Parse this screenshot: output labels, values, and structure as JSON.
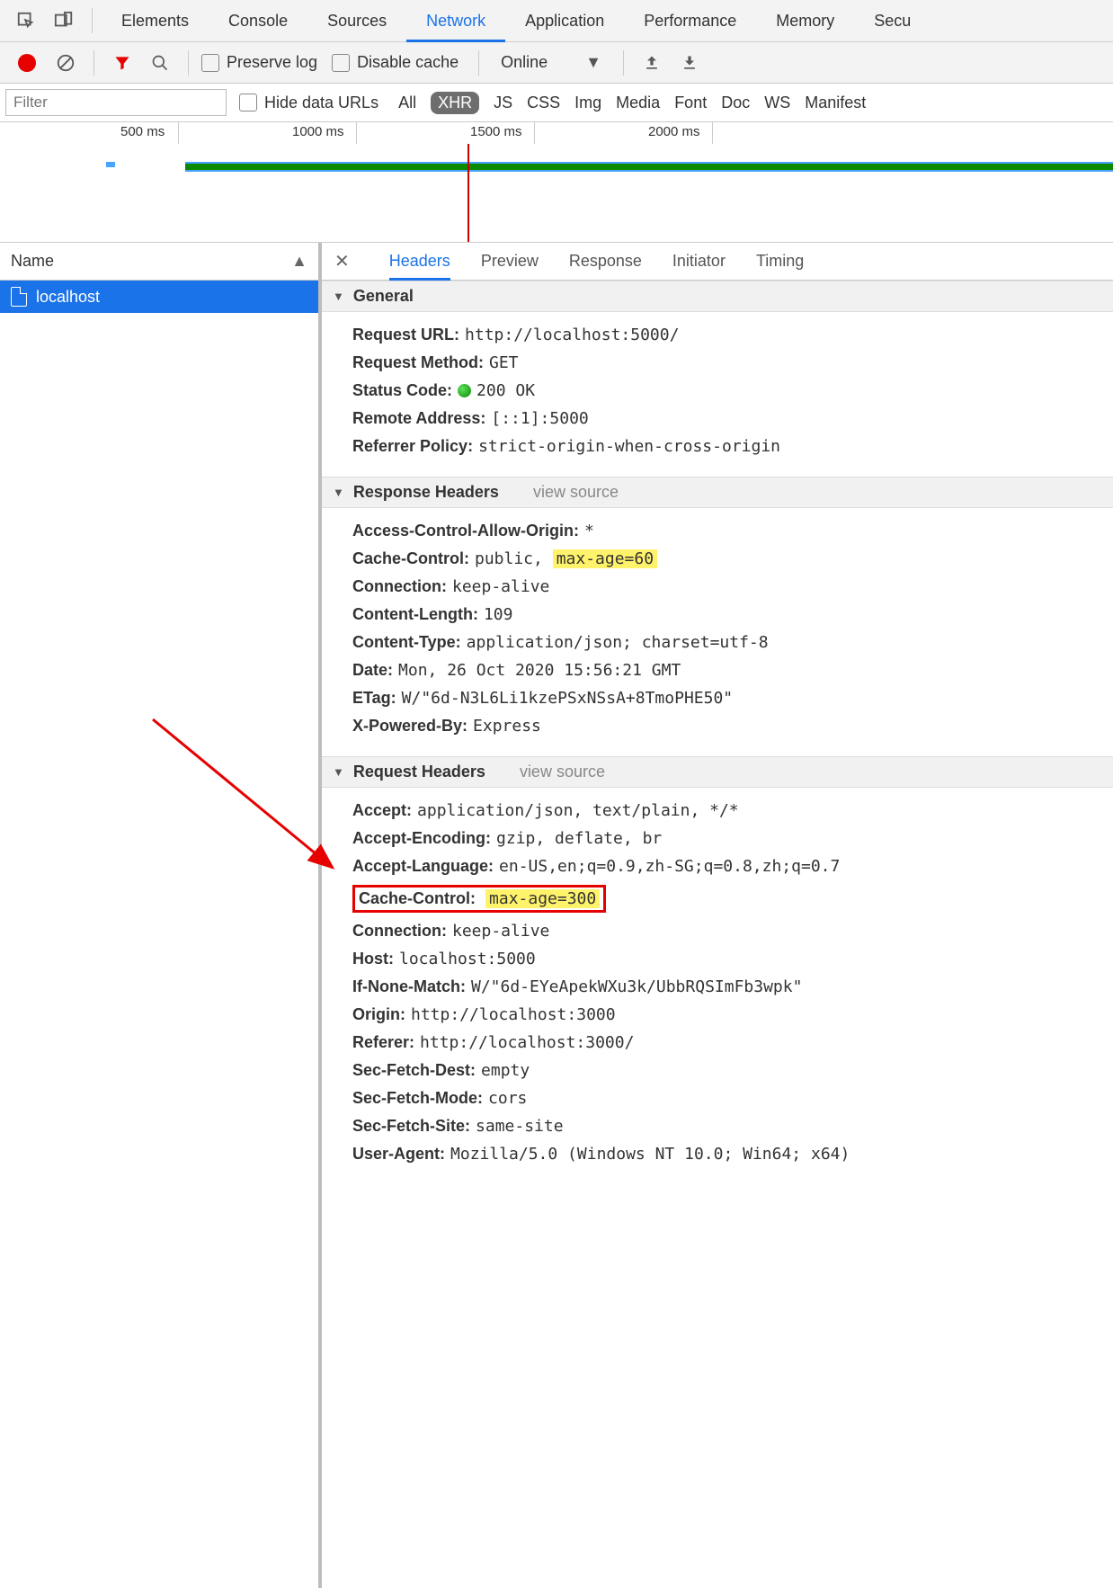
{
  "top_tabs": [
    "Elements",
    "Console",
    "Sources",
    "Network",
    "Application",
    "Performance",
    "Memory",
    "Secu"
  ],
  "top_active": "Network",
  "secondbar": {
    "preserve_log": "Preserve log",
    "disable_cache": "Disable cache",
    "throttle": "Online"
  },
  "filterbar": {
    "placeholder": "Filter",
    "hide_urls": "Hide data URLs",
    "types": [
      "All",
      "XHR",
      "JS",
      "CSS",
      "Img",
      "Media",
      "Font",
      "Doc",
      "WS",
      "Manifest"
    ],
    "type_active": "XHR"
  },
  "timeline": {
    "labels": [
      "500 ms",
      "1000 ms",
      "1500 ms",
      "2000 ms"
    ]
  },
  "left": {
    "col": "Name",
    "items": [
      "localhost"
    ]
  },
  "detail_tabs": [
    "Headers",
    "Preview",
    "Response",
    "Initiator",
    "Timing"
  ],
  "detail_active": "Headers",
  "sections": {
    "general": "General",
    "response": "Response Headers",
    "request": "Request Headers",
    "view_source": "view source"
  },
  "general": {
    "Request URL:": "http://localhost:5000/",
    "Request Method:": "GET",
    "Status Code:": "200 OK",
    "Remote Address:": "[::1]:5000",
    "Referrer Policy:": "strict-origin-when-cross-origin"
  },
  "response_headers": {
    "Access-Control-Allow-Origin:": "*",
    "Cache-Control:_pre": "public, ",
    "Cache-Control:_hl": "max-age=60",
    "Connection:": "keep-alive",
    "Content-Length:": "109",
    "Content-Type:": "application/json; charset=utf-8",
    "Date:": "Mon, 26 Oct 2020 15:56:21 GMT",
    "ETag:": "W/\"6d-N3L6Li1kzePSxNSsA+8TmoPHE50\"",
    "X-Powered-By:": "Express"
  },
  "request_headers": {
    "Accept:": "application/json, text/plain, */*",
    "Accept-Encoding:": "gzip, deflate, br",
    "Accept-Language:": "en-US,en;q=0.9,zh-SG;q=0.8,zh;q=0.7",
    "Cache-Control:_hl": "max-age=300",
    "Connection:": "keep-alive",
    "Host:": "localhost:5000",
    "If-None-Match:": "W/\"6d-EYeApekWXu3k/UbbRQSImFb3wpk\"",
    "Origin:": "http://localhost:3000",
    "Referer:": "http://localhost:3000/",
    "Sec-Fetch-Dest:": "empty",
    "Sec-Fetch-Mode:": "cors",
    "Sec-Fetch-Site:": "same-site",
    "User-Agent:": "Mozilla/5.0 (Windows NT 10.0; Win64; x64) "
  }
}
